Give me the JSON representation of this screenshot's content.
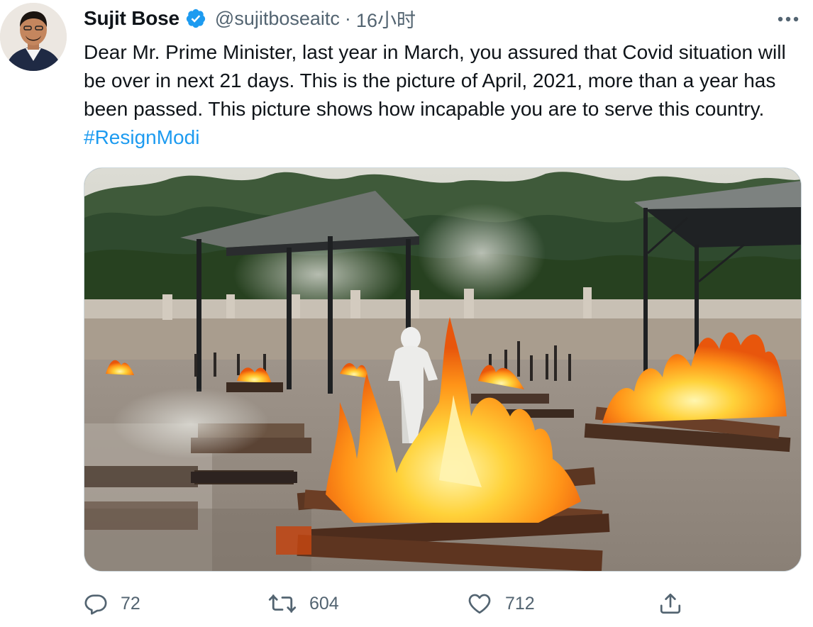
{
  "tweet": {
    "display_name": "Sujit Bose",
    "handle": "@sujitboseaitc",
    "separator": "·",
    "time": "16小时",
    "text": "Dear Mr. Prime Minister, last year in March, you assured that Covid situation will be over in next 21 days. This is the picture of April, 2021, more than a year has been passed. This picture shows how incapable you are to serve this country. ",
    "hashtag": "#ResignModi",
    "verified": true
  },
  "actions": {
    "reply_count": "72",
    "retweet_count": "604",
    "like_count": "712"
  },
  "icons": {
    "verified": "verified-badge-icon",
    "more": "more-dots-icon",
    "reply": "reply-icon",
    "retweet": "retweet-icon",
    "like": "heart-icon",
    "share": "share-icon"
  },
  "colors": {
    "link": "#1d9bf0",
    "secondary_text": "#536471",
    "primary_text": "#0f1419",
    "verified": "#1d9bf0"
  }
}
